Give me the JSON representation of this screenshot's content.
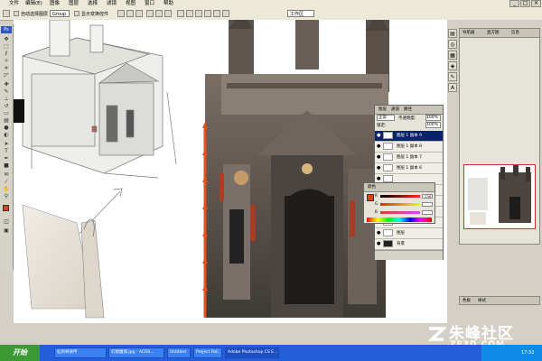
{
  "menubar": {
    "items": [
      "文件",
      "编辑(E)",
      "图像",
      "图层",
      "选择",
      "滤镜",
      "视图",
      "窗口",
      "帮助"
    ]
  },
  "options": {
    "auto_select_label": "自动选择图层",
    "group_value": "Group",
    "show_transform_label": "显示变换控件",
    "workspace_label": "工作区"
  },
  "layers": {
    "blend_mode": "正常",
    "opacity_label": "不透明度:",
    "opacity_value": "100%",
    "lock_label": "锁定:",
    "fill_value": "100%",
    "tabs": [
      "图层",
      "通道",
      "路径"
    ],
    "rows": [
      {
        "name": "图层 1 副本 9",
        "selected": true
      },
      {
        "name": "图层 1 副本 8",
        "selected": false
      },
      {
        "name": "图层 1 副本 7",
        "selected": false
      },
      {
        "name": "图层 1 副本 6",
        "selected": false
      },
      {
        "name": "",
        "selected": false
      },
      {
        "name": "",
        "selected": false
      },
      {
        "name": "",
        "selected": false
      },
      {
        "name": "",
        "selected": false
      },
      {
        "name": "图层 1",
        "selected": false
      },
      {
        "name": "图层 ",
        "selected": false
      },
      {
        "name": "背景",
        "selected": false
      }
    ]
  },
  "color_panel": {
    "title": "颜色",
    "r_label": "R",
    "g_label": "G",
    "b_label": "B",
    "r_value": "236",
    "g_value": "",
    "b_value": ""
  },
  "navigator": {
    "tabs": [
      "导航器",
      "直方图",
      "信息"
    ]
  },
  "bottom_panel": {
    "tabs": [
      "色板",
      "样式"
    ]
  },
  "taskbar": {
    "start": "开始",
    "clock": "17:32",
    "tasks": [
      {
        "label": "仙剑奇侠传",
        "active": false
      },
      {
        "label": "幻想魔城.jpg - ACDS...",
        "active": false
      },
      {
        "label": "Untitled",
        "active": false
      },
      {
        "label": "Project Poli...",
        "active": false
      },
      {
        "label": "Adobe Photoshop CS E...",
        "active": true
      }
    ]
  },
  "watermark": {
    "text": "朱峰社区",
    "url": "ZF3D.COM"
  },
  "colors": {
    "foreground": "#d8431c",
    "background": "#ffffff",
    "accent": "#0a246a"
  }
}
